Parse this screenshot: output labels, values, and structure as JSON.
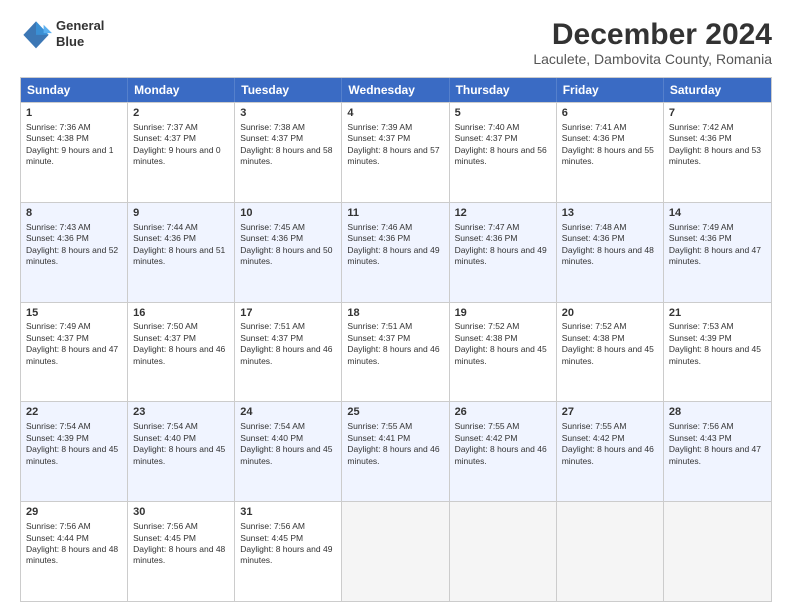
{
  "header": {
    "logo_line1": "General",
    "logo_line2": "Blue",
    "title": "December 2024",
    "subtitle": "Laculete, Dambovita County, Romania"
  },
  "days": [
    "Sunday",
    "Monday",
    "Tuesday",
    "Wednesday",
    "Thursday",
    "Friday",
    "Saturday"
  ],
  "rows": [
    [
      {
        "day": "1",
        "rise": "Sunrise: 7:36 AM",
        "set": "Sunset: 4:38 PM",
        "light": "Daylight: 9 hours and 1 minute."
      },
      {
        "day": "2",
        "rise": "Sunrise: 7:37 AM",
        "set": "Sunset: 4:37 PM",
        "light": "Daylight: 9 hours and 0 minutes."
      },
      {
        "day": "3",
        "rise": "Sunrise: 7:38 AM",
        "set": "Sunset: 4:37 PM",
        "light": "Daylight: 8 hours and 58 minutes."
      },
      {
        "day": "4",
        "rise": "Sunrise: 7:39 AM",
        "set": "Sunset: 4:37 PM",
        "light": "Daylight: 8 hours and 57 minutes."
      },
      {
        "day": "5",
        "rise": "Sunrise: 7:40 AM",
        "set": "Sunset: 4:37 PM",
        "light": "Daylight: 8 hours and 56 minutes."
      },
      {
        "day": "6",
        "rise": "Sunrise: 7:41 AM",
        "set": "Sunset: 4:36 PM",
        "light": "Daylight: 8 hours and 55 minutes."
      },
      {
        "day": "7",
        "rise": "Sunrise: 7:42 AM",
        "set": "Sunset: 4:36 PM",
        "light": "Daylight: 8 hours and 53 minutes."
      }
    ],
    [
      {
        "day": "8",
        "rise": "Sunrise: 7:43 AM",
        "set": "Sunset: 4:36 PM",
        "light": "Daylight: 8 hours and 52 minutes."
      },
      {
        "day": "9",
        "rise": "Sunrise: 7:44 AM",
        "set": "Sunset: 4:36 PM",
        "light": "Daylight: 8 hours and 51 minutes."
      },
      {
        "day": "10",
        "rise": "Sunrise: 7:45 AM",
        "set": "Sunset: 4:36 PM",
        "light": "Daylight: 8 hours and 50 minutes."
      },
      {
        "day": "11",
        "rise": "Sunrise: 7:46 AM",
        "set": "Sunset: 4:36 PM",
        "light": "Daylight: 8 hours and 49 minutes."
      },
      {
        "day": "12",
        "rise": "Sunrise: 7:47 AM",
        "set": "Sunset: 4:36 PM",
        "light": "Daylight: 8 hours and 49 minutes."
      },
      {
        "day": "13",
        "rise": "Sunrise: 7:48 AM",
        "set": "Sunset: 4:36 PM",
        "light": "Daylight: 8 hours and 48 minutes."
      },
      {
        "day": "14",
        "rise": "Sunrise: 7:49 AM",
        "set": "Sunset: 4:36 PM",
        "light": "Daylight: 8 hours and 47 minutes."
      }
    ],
    [
      {
        "day": "15",
        "rise": "Sunrise: 7:49 AM",
        "set": "Sunset: 4:37 PM",
        "light": "Daylight: 8 hours and 47 minutes."
      },
      {
        "day": "16",
        "rise": "Sunrise: 7:50 AM",
        "set": "Sunset: 4:37 PM",
        "light": "Daylight: 8 hours and 46 minutes."
      },
      {
        "day": "17",
        "rise": "Sunrise: 7:51 AM",
        "set": "Sunset: 4:37 PM",
        "light": "Daylight: 8 hours and 46 minutes."
      },
      {
        "day": "18",
        "rise": "Sunrise: 7:51 AM",
        "set": "Sunset: 4:37 PM",
        "light": "Daylight: 8 hours and 46 minutes."
      },
      {
        "day": "19",
        "rise": "Sunrise: 7:52 AM",
        "set": "Sunset: 4:38 PM",
        "light": "Daylight: 8 hours and 45 minutes."
      },
      {
        "day": "20",
        "rise": "Sunrise: 7:52 AM",
        "set": "Sunset: 4:38 PM",
        "light": "Daylight: 8 hours and 45 minutes."
      },
      {
        "day": "21",
        "rise": "Sunrise: 7:53 AM",
        "set": "Sunset: 4:39 PM",
        "light": "Daylight: 8 hours and 45 minutes."
      }
    ],
    [
      {
        "day": "22",
        "rise": "Sunrise: 7:54 AM",
        "set": "Sunset: 4:39 PM",
        "light": "Daylight: 8 hours and 45 minutes."
      },
      {
        "day": "23",
        "rise": "Sunrise: 7:54 AM",
        "set": "Sunset: 4:40 PM",
        "light": "Daylight: 8 hours and 45 minutes."
      },
      {
        "day": "24",
        "rise": "Sunrise: 7:54 AM",
        "set": "Sunset: 4:40 PM",
        "light": "Daylight: 8 hours and 45 minutes."
      },
      {
        "day": "25",
        "rise": "Sunrise: 7:55 AM",
        "set": "Sunset: 4:41 PM",
        "light": "Daylight: 8 hours and 46 minutes."
      },
      {
        "day": "26",
        "rise": "Sunrise: 7:55 AM",
        "set": "Sunset: 4:42 PM",
        "light": "Daylight: 8 hours and 46 minutes."
      },
      {
        "day": "27",
        "rise": "Sunrise: 7:55 AM",
        "set": "Sunset: 4:42 PM",
        "light": "Daylight: 8 hours and 46 minutes."
      },
      {
        "day": "28",
        "rise": "Sunrise: 7:56 AM",
        "set": "Sunset: 4:43 PM",
        "light": "Daylight: 8 hours and 47 minutes."
      }
    ],
    [
      {
        "day": "29",
        "rise": "Sunrise: 7:56 AM",
        "set": "Sunset: 4:44 PM",
        "light": "Daylight: 8 hours and 48 minutes."
      },
      {
        "day": "30",
        "rise": "Sunrise: 7:56 AM",
        "set": "Sunset: 4:45 PM",
        "light": "Daylight: 8 hours and 48 minutes."
      },
      {
        "day": "31",
        "rise": "Sunrise: 7:56 AM",
        "set": "Sunset: 4:45 PM",
        "light": "Daylight: 8 hours and 49 minutes."
      },
      null,
      null,
      null,
      null
    ]
  ],
  "alt_rows": [
    1,
    3
  ]
}
